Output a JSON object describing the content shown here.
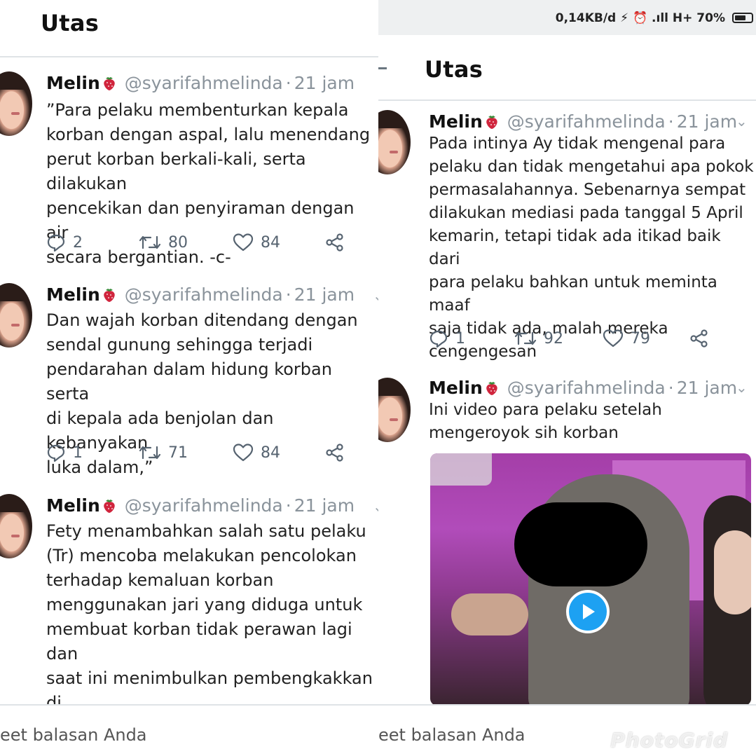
{
  "left_panel": {
    "header_title": "Utas",
    "reply_placeholder": "eet balasan Anda",
    "tweets": [
      {
        "name": "Melin",
        "handle": "@syarifahmelinda",
        "dot": "·",
        "time": "21 jam",
        "text": "”Para pelaku membenturkan kepala\nkorban dengan aspal, lalu menendang\nperut korban berkali-kali, serta dilakukan\npencekikan dan penyiraman dengan air\nsecara bergantian. -c-",
        "replies": "2",
        "retweets": "80",
        "likes": "84"
      },
      {
        "name": "Melin",
        "handle": "@syarifahmelinda",
        "dot": "·",
        "time": "21 jam",
        "text": "Dan wajah korban ditendang dengan\nsendal gunung sehingga terjadi\npendarahan dalam hidung korban serta\ndi kepala ada benjolan dan kebanyakan\nluka dalam,”",
        "replies": "1",
        "retweets": "71",
        "likes": "84"
      },
      {
        "name": "Melin",
        "handle": "@syarifahmelinda",
        "dot": "·",
        "time": "21 jam",
        "text": "Fety menambahkan salah satu pelaku\n(Tr) mencoba melakukan pencolokan\nterhadap kemaluan korban\nmenggunakan jari yang diduga untuk\nmembuat korban tidak perawan lagi dan\nsaat ini menimbulkan pembengkakkan di\narea kewanitaan korban."
      }
    ]
  },
  "right_panel": {
    "status_bar": {
      "text": "0,14KB/d ⚡ ⏰ .ıll H+ 70%",
      "battery_level": 0.7
    },
    "header_title": "Utas",
    "reply_placeholder": "eet balasan Anda",
    "watermark": "PhotoGrid",
    "tweets": [
      {
        "name": "Melin",
        "handle": "@syarifahmelinda",
        "dot": "·",
        "time": "21 jam",
        "text": "Pada intinya Ay tidak mengenal para\npelaku dan tidak mengetahui apa pokok\npermasalahannya. Sebenarnya sempat\ndilakukan mediasi pada tanggal 5 April\nkemarin, tetapi tidak ada itikad baik dari\npara pelaku bahkan untuk meminta maaf\nsaja tidak ada, malah mereka\ncengengesan",
        "replies": "1",
        "retweets": "92",
        "likes": "79"
      },
      {
        "name": "Melin",
        "handle": "@syarifahmelinda",
        "dot": "·",
        "time": "21 jam",
        "text": "Ini video para pelaku setelah\nmengeroyok sih korban"
      }
    ]
  },
  "icons": {
    "reply": "reply-icon",
    "retweet": "retweet-icon",
    "like": "heart-icon",
    "share": "share-icon",
    "emoji": "strawberry-icon",
    "more": "chevron-down-icon",
    "play": "play-icon"
  },
  "colors": {
    "accent": "#1da1f2",
    "handle_gray": "#8a939b",
    "icon_gray": "#566370",
    "berry_red": "#d0253d"
  }
}
